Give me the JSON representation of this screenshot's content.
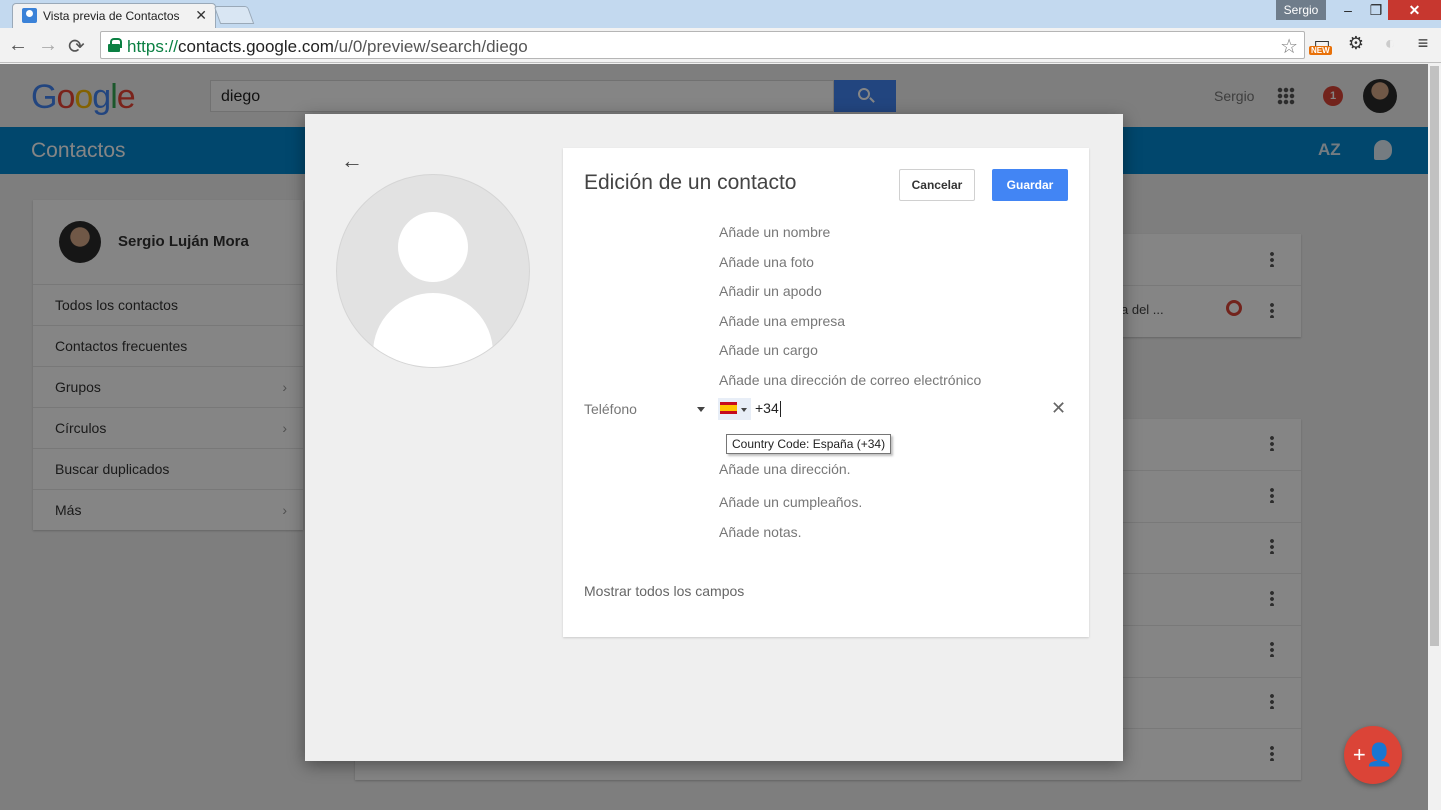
{
  "browser": {
    "tab_title": "Vista previa de Contactos",
    "tab_close": "✕",
    "profile_name": "Sergio",
    "win_min": "–",
    "win_max": "❐",
    "win_close": "✕",
    "url_scheme": "https://",
    "url_host": "contacts.google.com",
    "url_path": "/u/0/preview/search/diego",
    "new_badge": "NEW"
  },
  "app": {
    "logo_letters": [
      "G",
      "o",
      "o",
      "g",
      "l",
      "e"
    ],
    "search_value": "diego",
    "user_name": "Sergio",
    "notifications": "1",
    "section_title": "Contactos",
    "sort_label": "AZ"
  },
  "sidebar": {
    "profile_name": "Sergio Luján Mora",
    "items": [
      {
        "label": "Todos los contactos",
        "chevron": ""
      },
      {
        "label": "Contactos frecuentes",
        "chevron": ""
      },
      {
        "label": "Grupos",
        "chevron": "›"
      },
      {
        "label": "Círculos",
        "chevron": "›"
      },
      {
        "label": "Buscar duplicados",
        "chevron": ""
      },
      {
        "label": "Más",
        "chevron": "›"
      }
    ]
  },
  "list": {
    "snippet": "a del ..."
  },
  "dialog": {
    "title": "Edición de un contacto",
    "cancel": "Cancelar",
    "save": "Guardar",
    "add_name": "Añade un nombre",
    "add_photo": "Añade una foto",
    "add_nickname": "Añadir un apodo",
    "add_company": "Añade una empresa",
    "add_job": "Añade un cargo",
    "add_email": "Añade una dirección de correo electrónico",
    "phone_label": "Teléfono",
    "phone_value": "+34",
    "tooltip": "Country Code: España (+34)",
    "add_address": "Añade una dirección.",
    "add_birthday": "Añade un cumpleaños.",
    "add_notes": "Añade notas.",
    "show_all": "Mostrar todos los campos"
  },
  "colors": {
    "brand_blue": "#0288d1",
    "primary_button": "#4285f4",
    "fab_red": "#db4437"
  },
  "icons": {
    "back": "←",
    "forward": "→",
    "reload": "⟳",
    "star": "☆",
    "gear": "⚙",
    "menu": "≡",
    "clear": "✕",
    "add_person": "+👤"
  }
}
